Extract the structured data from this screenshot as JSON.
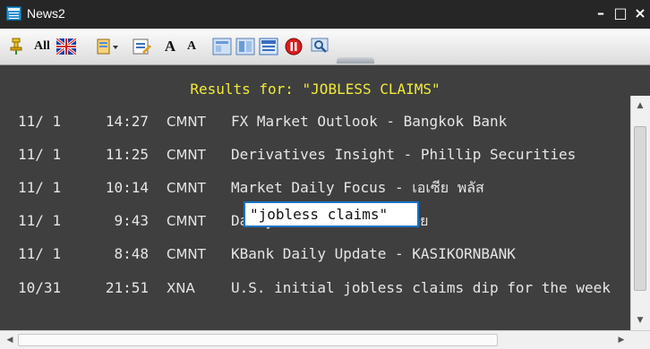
{
  "window": {
    "title": "News2",
    "controls": {
      "minimize": "–",
      "maximize": "□",
      "close": "×"
    }
  },
  "toolbar": {
    "all_label": "All",
    "font_increase_label": "A",
    "font_decrease_label": "A"
  },
  "results": {
    "title": "Results for: \"JOBLESS CLAIMS\"",
    "rows": [
      {
        "date": "11/ 1",
        "time": "14:27",
        "source": "CMNT",
        "headline": "FX Market Outlook - Bangkok Bank"
      },
      {
        "date": "11/ 1",
        "time": "11:25",
        "source": "CMNT",
        "headline": "Derivatives Insight - Phillip Securities"
      },
      {
        "date": "11/ 1",
        "time": "10:14",
        "source": "CMNT",
        "headline": "Market Daily Focus - เอเซีย พลัส"
      },
      {
        "date": "11/ 1",
        "time": "9:43",
        "source": "CMNT",
        "headline": "Daily View - บล.กสิกรไทย"
      },
      {
        "date": "11/ 1",
        "time": "8:48",
        "source": "CMNT",
        "headline": "KBank Daily Update - KASIKORNBANK"
      },
      {
        "date": "10/31",
        "time": "21:51",
        "source": "XNA",
        "headline": "U.S. initial jobless claims dip for the week"
      }
    ]
  },
  "search_popup": {
    "value": "\"jobless claims\""
  },
  "colors": {
    "title_bar_bg": "#262626",
    "content_bg": "#3f3f3f",
    "results_title": "#f2ea3f",
    "row_text": "#e6e6e6",
    "popup_border": "#1573c5"
  }
}
